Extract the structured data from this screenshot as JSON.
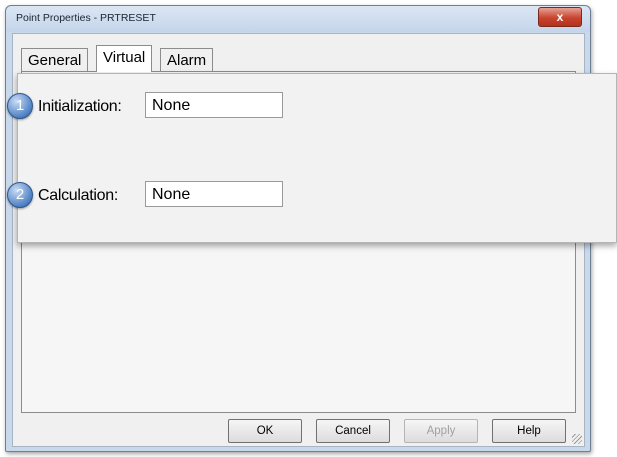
{
  "window": {
    "title": "Point Properties - PRTRESET",
    "close_glyph": "x"
  },
  "tabs": [
    {
      "label": "General",
      "active": false
    },
    {
      "label": "Virtual",
      "active": true
    },
    {
      "label": "Alarm",
      "active": false
    }
  ],
  "buttons": {
    "ok": "OK",
    "cancel": "Cancel",
    "apply": "Apply",
    "help": "Help"
  },
  "callout": {
    "fields": [
      {
        "badge": "1",
        "label": "Initialization:",
        "value": "None"
      },
      {
        "badge": "2",
        "label": "Calculation:",
        "value": "None"
      }
    ]
  },
  "colors": {
    "accent": "#4f81c4",
    "close_button": "#c7452f",
    "titlebar": "#c4d5ea"
  }
}
